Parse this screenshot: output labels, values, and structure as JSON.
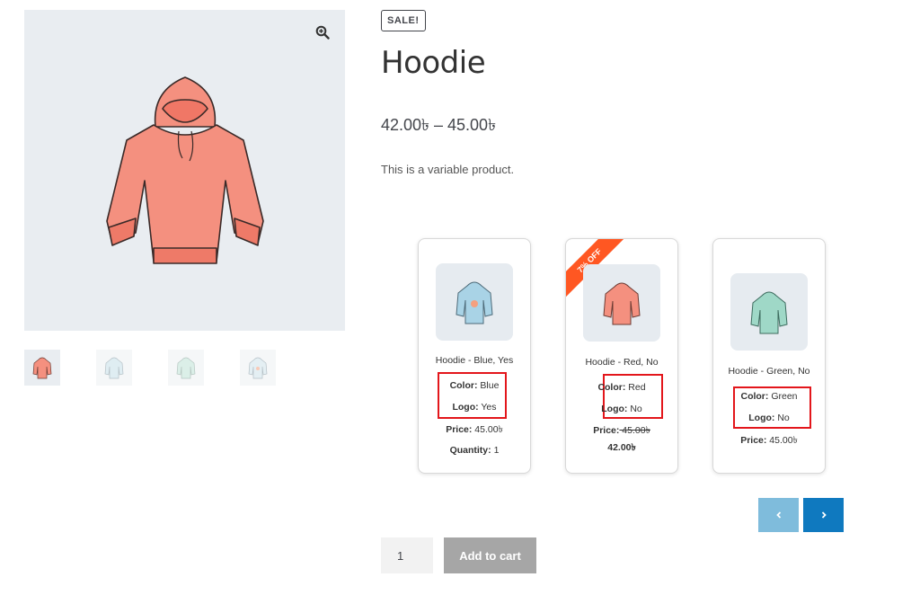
{
  "gallery": {
    "zoom_icon": "zoom-in-icon",
    "main_image": "orange hoodie",
    "thumbnails": [
      "orange hoodie",
      "blue hoodie",
      "green hoodie",
      "blue hoodie with logo"
    ]
  },
  "product": {
    "badge": "SALE!",
    "title": "Hoodie",
    "price_range": "42.00৳ – 45.00৳",
    "description": "This is a variable product."
  },
  "variations": [
    {
      "name": "Hoodie - Blue, Yes",
      "color_label": "Color:",
      "color_value": " Blue",
      "logo_label": "Logo:",
      "logo_value": " Yes",
      "price_label": "Price:",
      "price": " 45.00৳",
      "qty_label": "Quantity:",
      "qty": " 1",
      "hoodie_color": "#a9d3e6"
    },
    {
      "name": "Hoodie - Red, No",
      "ribbon": "7% OFF",
      "color_label": "Color:",
      "color_value": " Red",
      "logo_label": "Logo:",
      "logo_value": " No",
      "price_label": "Price:",
      "price_old": " 45.00৳",
      "price_new": "42.00৳",
      "hoodie_color": "#f4907f"
    },
    {
      "name": "Hoodie - Green, No",
      "color_label": "Color:",
      "color_value": " Green",
      "logo_label": "Logo:",
      "logo_value": " No",
      "price_label": "Price:",
      "price": " 45.00৳",
      "hoodie_color": "#9fd8c7"
    }
  ],
  "carousel": {
    "prev_icon": "chevron-left-icon",
    "next_icon": "chevron-right-icon"
  },
  "cart": {
    "quantity": "1",
    "add_label": "Add to cart"
  },
  "colors": {
    "highlight_border": "#e3161b",
    "ribbon": "#ff5722",
    "nav_prev": "#7fbcdc",
    "nav_next": "#0f79bf",
    "image_bg": "#e9edf1"
  }
}
